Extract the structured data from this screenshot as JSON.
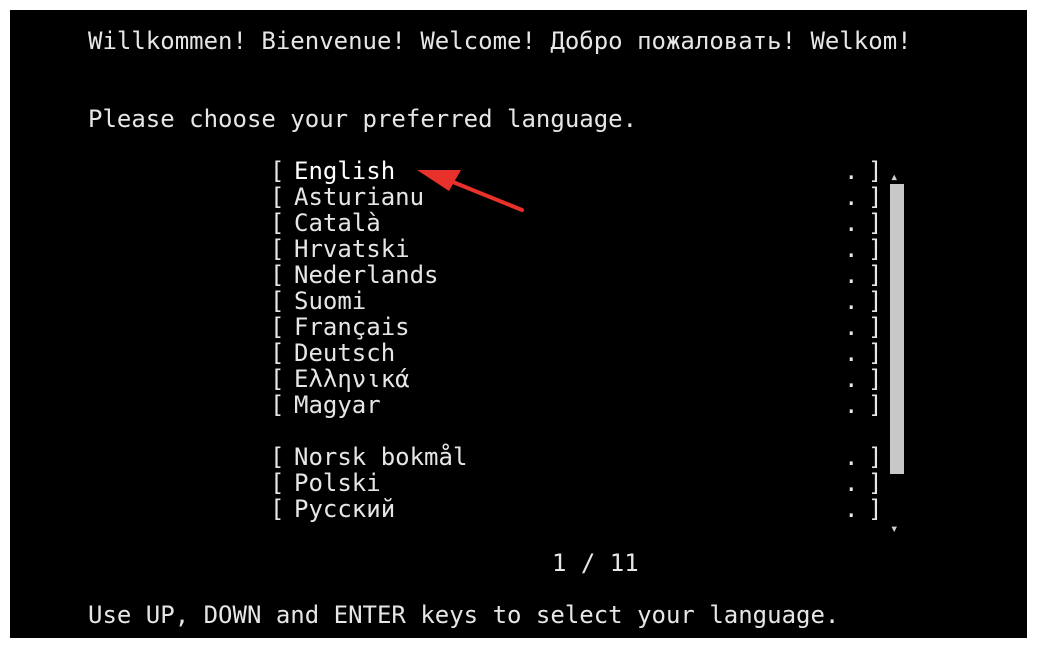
{
  "header": {
    "welcome": "Willkommen! Bienvenue! Welcome! Добро пожаловать! Welkom!",
    "prompt": "Please choose your preferred language."
  },
  "languages": [
    {
      "label": "English",
      "selected": true
    },
    {
      "label": "Asturianu"
    },
    {
      "label": "Català"
    },
    {
      "label": "Hrvatski"
    },
    {
      "label": "Nederlands"
    },
    {
      "label": "Suomi"
    },
    {
      "label": "Français"
    },
    {
      "label": "Deutsch"
    },
    {
      "label": "Ελληνικά"
    },
    {
      "label": "Magyar"
    },
    {
      "label": "Norsk bokmål"
    },
    {
      "label": "Polski"
    },
    {
      "label": "Русский"
    }
  ],
  "bracket_left": "[",
  "bracket_right": "]",
  "row_dot": ".",
  "pager": "1 / 11",
  "footer": {
    "hint": "Use UP, DOWN and ENTER keys to select your language."
  },
  "scrollbar": {
    "up_glyph": "▴",
    "down_glyph": "▾"
  },
  "annotation": {
    "arrow_color": "#e8312a"
  },
  "colors": {
    "background": "#000000",
    "text": "#e6e6e6"
  }
}
